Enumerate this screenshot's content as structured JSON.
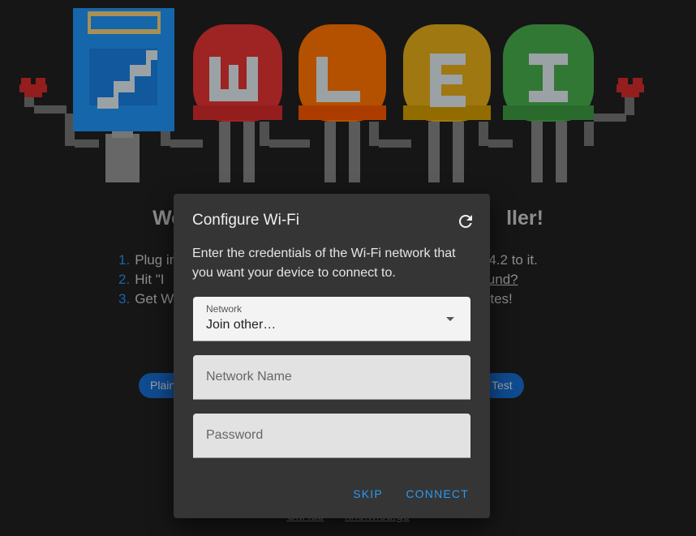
{
  "background": {
    "title_left": "Wel",
    "title_right": "ller!",
    "steps": [
      {
        "num": "1.",
        "text_left": "Plug in",
        "text_right": ".14.2 to it."
      },
      {
        "num": "2.",
        "text_left": "Hit \"I",
        "text_right": "e found?"
      },
      {
        "num": "3.",
        "text_left": "Get W",
        "text_right": "tes!"
      }
    ],
    "chip_left": "Plain",
    "chip_right": "Test",
    "footer_links": [
      "GitHub",
      "kno.wled.ge"
    ],
    "logo_letters": [
      "W",
      "L",
      "E",
      "D"
    ],
    "logo_colors": {
      "blue": "#1e88e5",
      "red": "#d32f2f",
      "orange": "#ef6c00",
      "yellow": "#d4a017",
      "green": "#43a047"
    }
  },
  "dialog": {
    "title": "Configure Wi-Fi",
    "refresh_icon": "refresh-icon",
    "description": "Enter the credentials of the Wi-Fi network that you want your device to connect to.",
    "network_select": {
      "label": "Network",
      "value": "Join other…"
    },
    "network_name": {
      "placeholder": "Network Name",
      "value": ""
    },
    "password": {
      "placeholder": "Password",
      "value": ""
    },
    "skip_label": "SKIP",
    "connect_label": "CONNECT"
  }
}
